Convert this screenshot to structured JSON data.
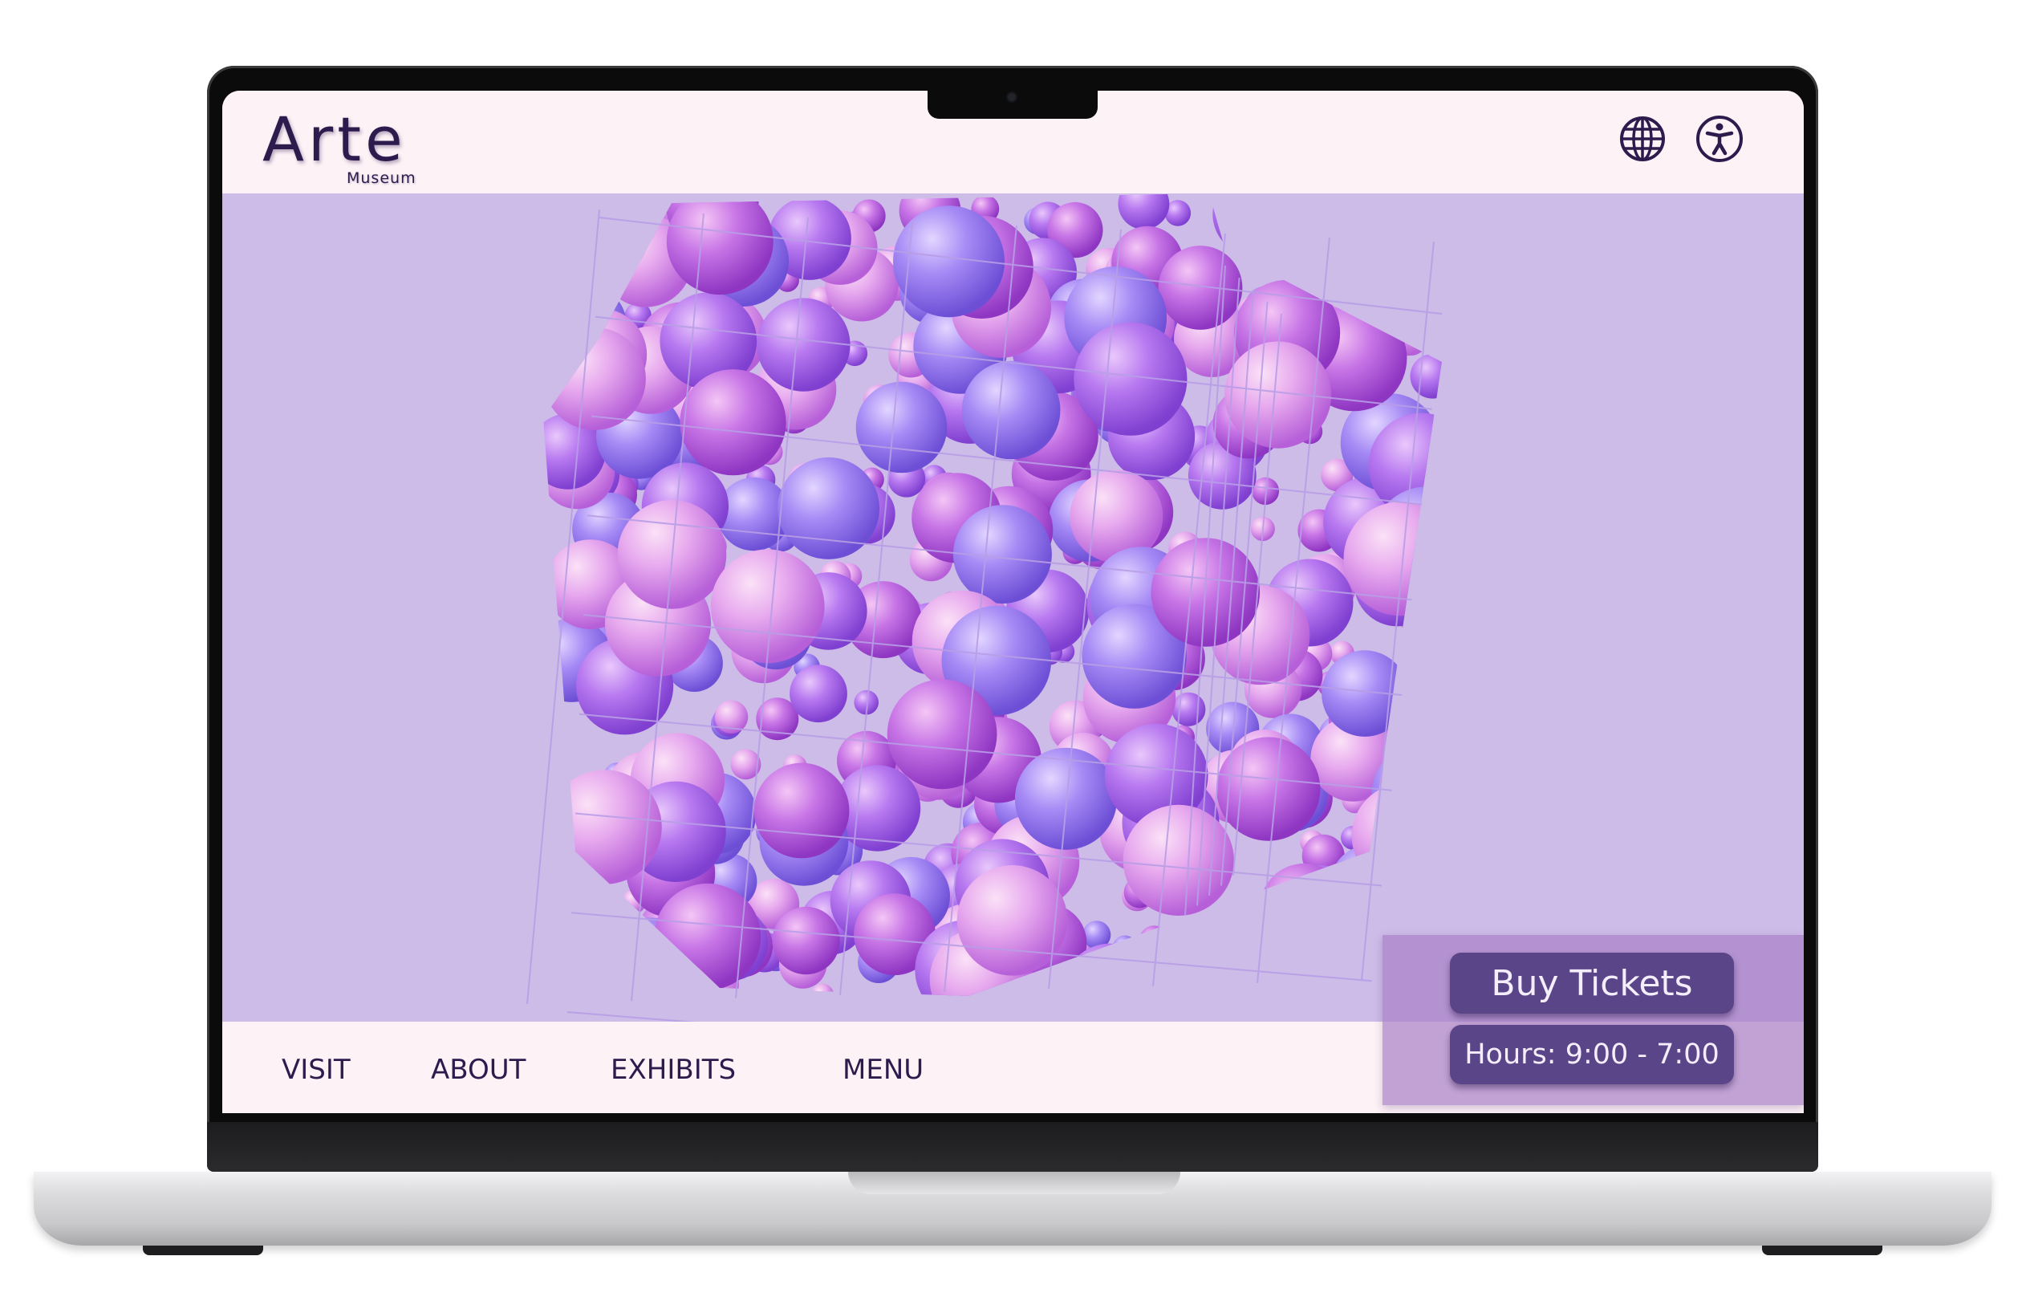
{
  "header": {
    "logo_word": "Arte",
    "logo_sub": "Museum",
    "icons": [
      "globe-icon",
      "accessibility-icon"
    ]
  },
  "hero": {
    "image": "purple-spheres-in-wire-cube"
  },
  "nav": {
    "items": [
      {
        "label": "VISIT"
      },
      {
        "label": "ABOUT"
      },
      {
        "label": "EXHIBITS"
      },
      {
        "label": "MENU"
      }
    ]
  },
  "tickets": {
    "buy_label": "Buy Tickets",
    "hours_label": "Hours: 9:00 - 7:00"
  },
  "colors": {
    "brand_dark": "#2d1b4e",
    "button": "#5b4589",
    "hero_bg": "#cdbbe8",
    "page_bg": "#fdf2f6"
  }
}
